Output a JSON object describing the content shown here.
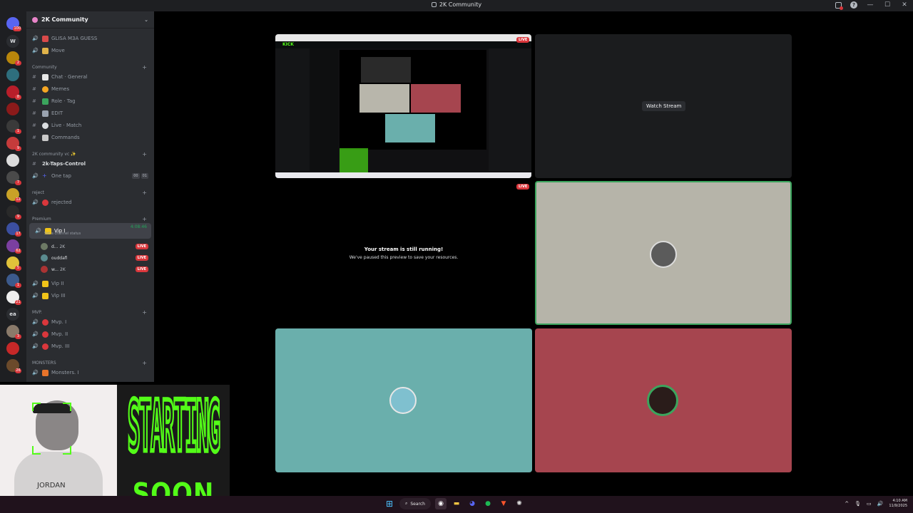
{
  "window": {
    "title": "2K Community"
  },
  "server": {
    "name": "2K Community"
  },
  "sidebar": {
    "top_rows": [
      {
        "label": "GLISA M3A GUESS",
        "emoji": "phone"
      },
      {
        "label": "Move",
        "emoji": "hourglass"
      }
    ],
    "categories": [
      {
        "label": "Community",
        "rows": [
          "Chat · General",
          "Memes",
          "Role · Tag",
          "EDIT",
          "Live · Match",
          "Commands"
        ]
      },
      {
        "label": "2K community vc ✨",
        "rows": [
          "2k-Taps-Control",
          "One tap"
        ]
      },
      {
        "label": "reject",
        "rows": [
          "rejected"
        ]
      },
      {
        "label": "Premium",
        "rows": [
          "Vip I",
          "Vip II",
          "Vip III"
        ]
      },
      {
        "label": "MVP.",
        "rows": [
          "Mvp. I",
          "Mvp. II",
          "Mvp. III"
        ]
      },
      {
        "label": "MONSTERS",
        "rows": [
          "Monsters. I"
        ]
      }
    ],
    "one_tap_tags": [
      "00",
      "01"
    ],
    "vip_status_placeholder": "Set a channel status",
    "vip_timer": "4:08:46",
    "vip_members": [
      {
        "name": "d...",
        "tag": "2K",
        "live": "LIVE"
      },
      {
        "name": "ouddafi",
        "tag": "",
        "live": "LIVE"
      },
      {
        "name": "w...",
        "tag": "2K",
        "live": "LIVE"
      }
    ],
    "rail_badges": [
      "100",
      "2",
      "8",
      "1",
      "9",
      "7",
      "12",
      "9",
      "17",
      "62",
      "5",
      "1",
      "21",
      "ea",
      "3",
      "26"
    ]
  },
  "stage": {
    "live_label": "LIVE",
    "watch_stream": "Watch Stream",
    "paused_title": "Your stream is still running!",
    "paused_sub": "We've paused this preview to save your resources."
  },
  "overlay": {
    "starting_line1": "STARTING",
    "starting_line2": "SOON"
  },
  "taskbar": {
    "search": "Search",
    "time": "4:10 AM",
    "date": "11/9/2025"
  },
  "colors": {
    "tile_gray": "#b6b4a9",
    "tile_teal": "#6aafac",
    "tile_red": "#a6454f",
    "speaking_border": "#3ba55d",
    "kick_green": "#53fc18",
    "live_red": "#da373c"
  }
}
